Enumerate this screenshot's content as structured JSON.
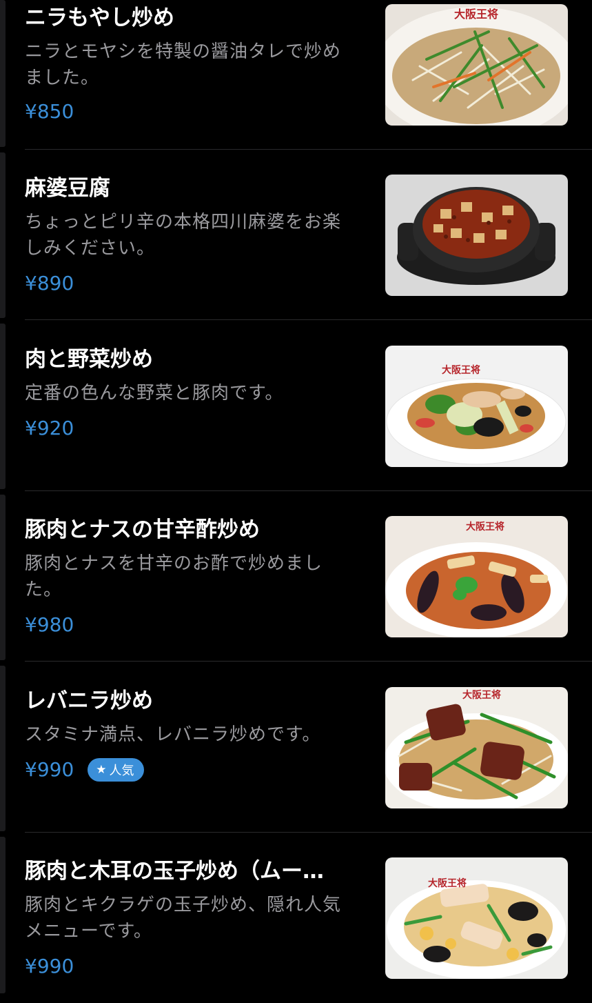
{
  "menu": {
    "items": [
      {
        "title": "ニラもやし炒め",
        "description": "ニラとモヤシを特製の醤油タレで炒めました。",
        "price": "¥850",
        "badge": null
      },
      {
        "title": "麻婆豆腐",
        "description": "ちょっとピリ辛の本格四川麻婆をお楽しみください。",
        "price": "¥890",
        "badge": null
      },
      {
        "title": "肉と野菜炒め",
        "description": "定番の色んな野菜と豚肉です。",
        "price": "¥920",
        "badge": null
      },
      {
        "title": "豚肉とナスの甘辛酢炒め",
        "description": "豚肉とナスを甘辛のお酢で炒めました。",
        "price": "¥980",
        "badge": null
      },
      {
        "title": "レバニラ炒め",
        "description": "スタミナ満点、レバニラ炒めです。",
        "price": "¥990",
        "badge": "人気",
        "badge_icon": "star-icon"
      },
      {
        "title": "豚肉と木耳の玉子炒め（ムー…",
        "description": "豚肉とキクラゲの玉子炒め、隠れ人気メニューです。",
        "price": "¥990",
        "badge": null
      }
    ],
    "image_brand_text": "大阪王将"
  },
  "colors": {
    "background": "#000000",
    "title": "#ffffff",
    "description": "#9a9a9e",
    "price": "#3b8fd9",
    "badge": "#3b8fd9",
    "divider": "#2a2a2c"
  }
}
